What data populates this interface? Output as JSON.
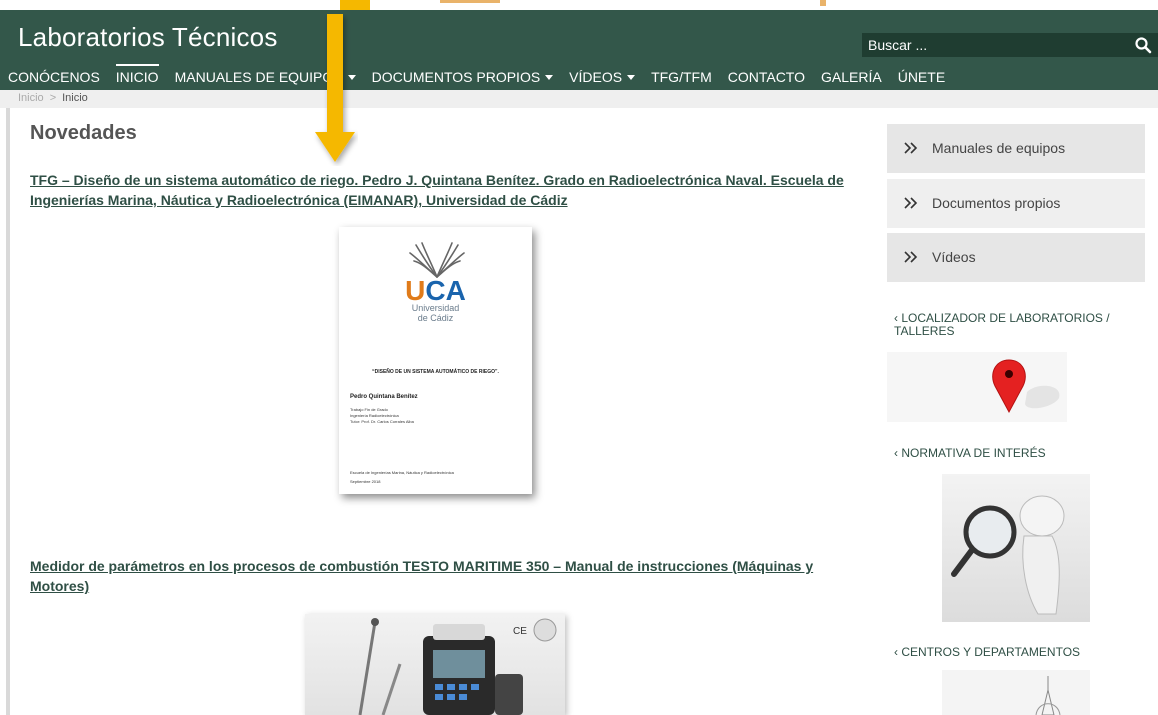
{
  "header": {
    "site_title": "Laboratorios Técnicos",
    "search_placeholder": "Buscar ..."
  },
  "nav": {
    "items": [
      {
        "label": "CONÓCENOS"
      },
      {
        "label": "INICIO"
      },
      {
        "label": "MANUALES DE EQUIPOS"
      },
      {
        "label": "DOCUMENTOS PROPIOS"
      },
      {
        "label": "VÍDEOS"
      },
      {
        "label": "TFG/TFM"
      },
      {
        "label": "CONTACTO"
      },
      {
        "label": "GALERÍA"
      },
      {
        "label": "ÚNETE"
      }
    ]
  },
  "breadcrumb": {
    "home": "Inicio",
    "separator": ">",
    "current": "Inicio"
  },
  "main": {
    "section_title": "Novedades",
    "posts": [
      {
        "title": "TFG – Diseño de un sistema automático de riego. Pedro J. Quintana Benítez. Grado en Radioelectrónica Naval. Escuela de Ingenierías Marina, Náutica y Radioelectrónica (EIMANAR), Universidad de Cádiz"
      },
      {
        "title": "Medidor de parámetros en los procesos de combustión TESTO MARITIME 350 – Manual de instrucciones (Máquinas y Motores)"
      }
    ],
    "doc_cover": {
      "logo_text": "UCA",
      "university_line1": "Universidad",
      "university_line2": "de Cádiz",
      "title": "“DISEÑO DE UN SISTEMA AUTOMÁTICO DE RIEGO”.",
      "author": "Pedro Quintana Benítez",
      "line1": "Trabajo Fin de Grado",
      "line2": "Ingeniería Radioelectrónica",
      "line3": "Tutor: Prof. Dr. Carlos Corrales Alba",
      "school": "Escuela de Ingenierías Marina, Náutica y Radioelectrónica",
      "date": "Septiembre 2018"
    },
    "product_badge": "CE"
  },
  "sidebar": {
    "buttons": [
      {
        "label": "Manuales de equipos"
      },
      {
        "label": "Documentos propios"
      },
      {
        "label": "Vídeos"
      }
    ],
    "headings": [
      {
        "label": "‹ LOCALIZADOR DE LABORATORIOS / TALLERES"
      },
      {
        "label": "‹ NORMATIVA DE INTERÉS"
      },
      {
        "label": "‹ CENTROS Y DEPARTAMENTOS"
      }
    ]
  },
  "colors": {
    "header_green": "#33574a",
    "search_dark": "#1f3d31",
    "link_green": "#2f4f45",
    "arrow_orange": "#f5b800",
    "sidebar_gray": "#e6e6e6"
  }
}
